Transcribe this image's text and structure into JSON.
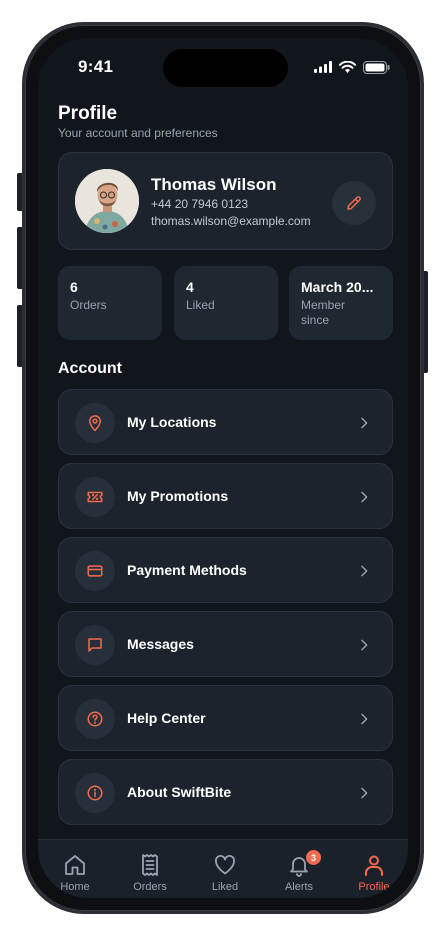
{
  "status_bar": {
    "time": "9:41"
  },
  "header": {
    "title": "Profile",
    "subtitle": "Your account and preferences"
  },
  "profile": {
    "name": "Thomas Wilson",
    "phone": "+44 20 7946 0123",
    "email": "thomas.wilson@example.com"
  },
  "stats": [
    {
      "value": "6",
      "label": "Orders"
    },
    {
      "value": "4",
      "label": "Liked"
    },
    {
      "value": "March 20...",
      "label": "Member since"
    }
  ],
  "account": {
    "heading": "Account",
    "items": [
      {
        "label": "My Locations",
        "icon": "location-pin-icon"
      },
      {
        "label": "My Promotions",
        "icon": "ticket-icon"
      },
      {
        "label": "Payment Methods",
        "icon": "credit-card-icon"
      },
      {
        "label": "Messages",
        "icon": "message-icon"
      },
      {
        "label": "Help Center",
        "icon": "help-circle-icon"
      },
      {
        "label": "About SwiftBite",
        "icon": "info-circle-icon"
      }
    ]
  },
  "tabbar": {
    "tabs": [
      {
        "label": "Home",
        "icon": "home-icon"
      },
      {
        "label": "Orders",
        "icon": "receipt-icon"
      },
      {
        "label": "Liked",
        "icon": "heart-icon"
      },
      {
        "label": "Alerts",
        "icon": "bell-icon",
        "badge": "3"
      },
      {
        "label": "Profile",
        "icon": "user-icon",
        "active": true
      }
    ]
  },
  "colors": {
    "accent": "#f26b4f",
    "background": "#11161c",
    "card": "#1c232c"
  }
}
